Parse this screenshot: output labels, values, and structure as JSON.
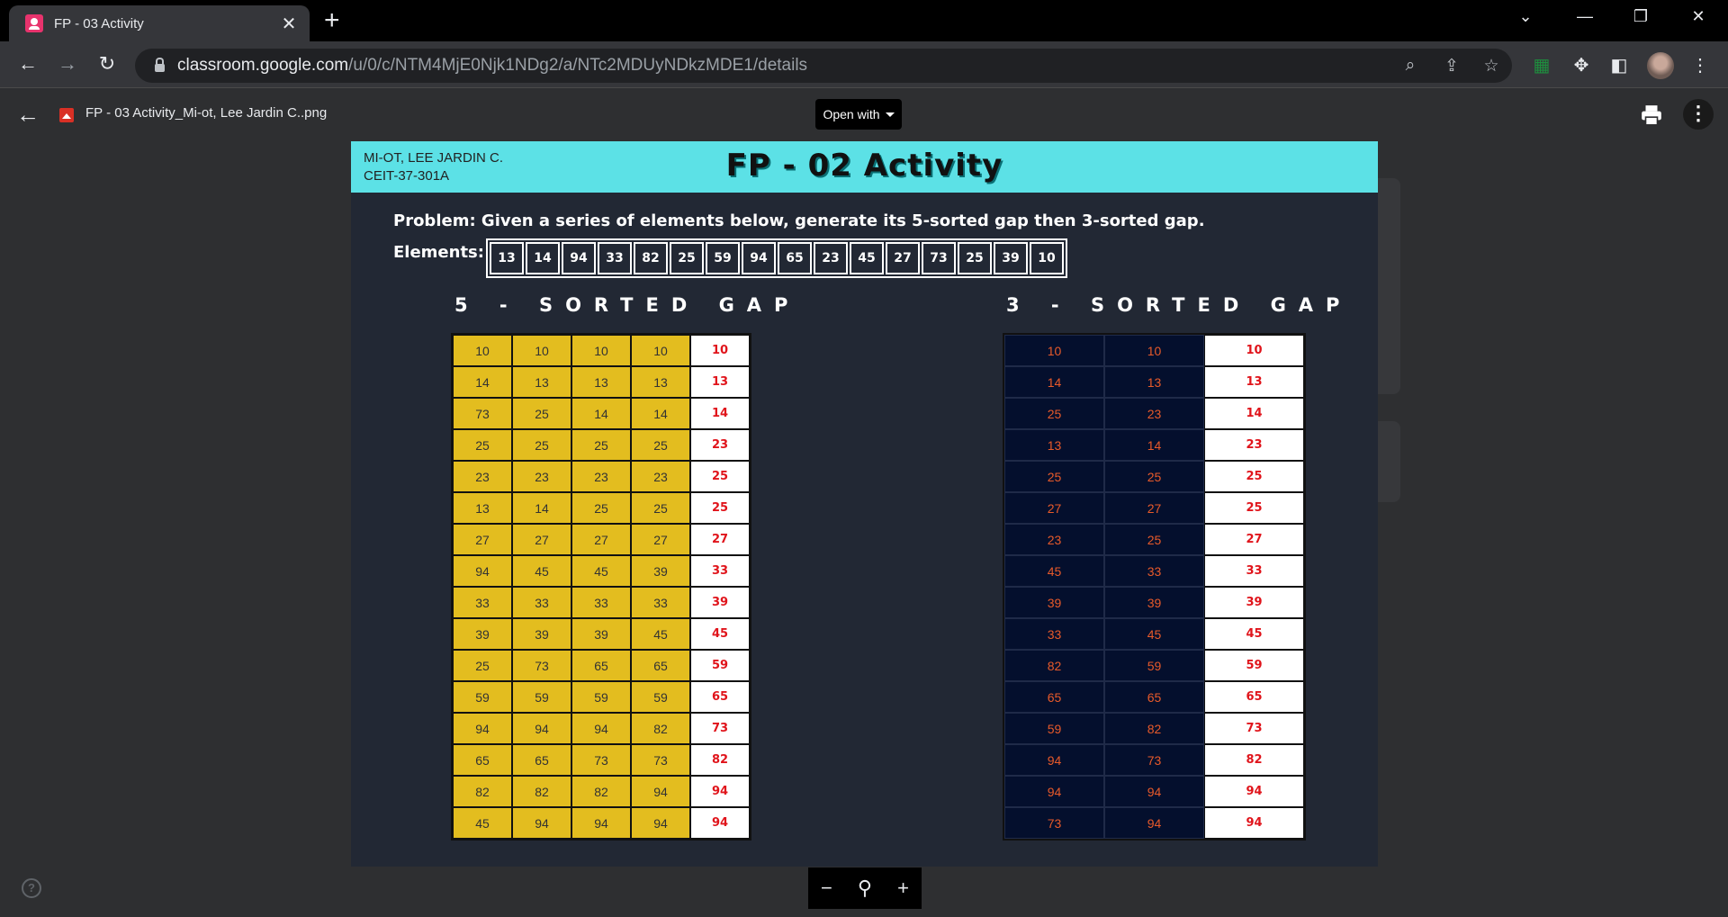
{
  "browser": {
    "tab_title": "FP - 03 Activity",
    "tab_close": "✕",
    "new_tab": "+",
    "url_domain": "classroom.google.com",
    "url_path": "/u/0/c/NTM4MjE0Njk1NDg2/a/NTc2MDUyNDkzMDE1/details"
  },
  "viewer": {
    "file_name": "FP - 03 Activity_Mi-ot, Lee Jardin C..png",
    "open_with": "Open with",
    "zoom_out": "−",
    "zoom_in": "+",
    "help": "?"
  },
  "document": {
    "student_name": "MI-OT, LEE JARDIN C.",
    "section": "CEIT-37-301A",
    "title": "FP - 02 Activity",
    "problem": "Problem: Given a series of elements below, generate its 5-sorted gap then 3-sorted gap.",
    "elements_label": "Elements:",
    "elements": [
      "13",
      "14",
      "94",
      "33",
      "82",
      "25",
      "59",
      "94",
      "65",
      "23",
      "45",
      "27",
      "73",
      "25",
      "39",
      "10"
    ],
    "gap5_title": "5 - SORTED GAP",
    "gap3_title": "3 - SORTED GAP",
    "gap5_rows": [
      [
        "10",
        "10",
        "10",
        "10",
        "10"
      ],
      [
        "14",
        "13",
        "13",
        "13",
        "13"
      ],
      [
        "73",
        "25",
        "14",
        "14",
        "14"
      ],
      [
        "25",
        "25",
        "25",
        "25",
        "23"
      ],
      [
        "23",
        "23",
        "23",
        "23",
        "25"
      ],
      [
        "13",
        "14",
        "25",
        "25",
        "25"
      ],
      [
        "27",
        "27",
        "27",
        "27",
        "27"
      ],
      [
        "94",
        "45",
        "45",
        "39",
        "33"
      ],
      [
        "33",
        "33",
        "33",
        "33",
        "39"
      ],
      [
        "39",
        "39",
        "39",
        "45",
        "45"
      ],
      [
        "25",
        "73",
        "65",
        "65",
        "59"
      ],
      [
        "59",
        "59",
        "59",
        "59",
        "65"
      ],
      [
        "94",
        "94",
        "94",
        "82",
        "73"
      ],
      [
        "65",
        "65",
        "73",
        "73",
        "82"
      ],
      [
        "82",
        "82",
        "82",
        "94",
        "94"
      ],
      [
        "45",
        "94",
        "94",
        "94",
        "94"
      ]
    ],
    "gap3_rows": [
      [
        "10",
        "10",
        "10"
      ],
      [
        "14",
        "13",
        "13"
      ],
      [
        "25",
        "23",
        "14"
      ],
      [
        "13",
        "14",
        "23"
      ],
      [
        "25",
        "25",
        "25"
      ],
      [
        "27",
        "27",
        "25"
      ],
      [
        "23",
        "25",
        "27"
      ],
      [
        "45",
        "33",
        "33"
      ],
      [
        "39",
        "39",
        "39"
      ],
      [
        "33",
        "45",
        "45"
      ],
      [
        "82",
        "59",
        "59"
      ],
      [
        "65",
        "65",
        "65"
      ],
      [
        "59",
        "82",
        "73"
      ],
      [
        "94",
        "73",
        "82"
      ],
      [
        "94",
        "94",
        "94"
      ],
      [
        "73",
        "94",
        "94"
      ]
    ]
  }
}
